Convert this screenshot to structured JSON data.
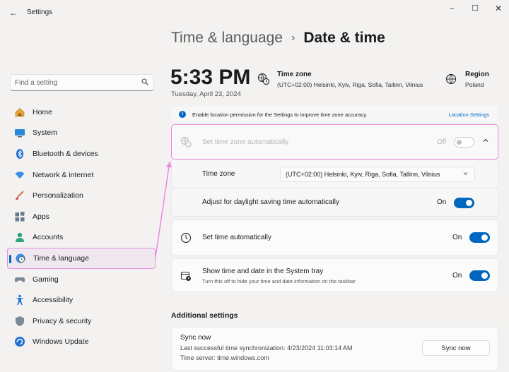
{
  "app": {
    "title": "Settings",
    "back_glyph": "←",
    "minimize_glyph": "–",
    "maximize_glyph": "☐",
    "close_glyph": "✕"
  },
  "search": {
    "placeholder": "Find a setting",
    "icon": "search-icon"
  },
  "sidebar": {
    "items": [
      {
        "label": "Home",
        "icon": "home-icon"
      },
      {
        "label": "System",
        "icon": "monitor-icon"
      },
      {
        "label": "Bluetooth & devices",
        "icon": "bluetooth-icon"
      },
      {
        "label": "Network & internet",
        "icon": "wifi-icon"
      },
      {
        "label": "Personalization",
        "icon": "brush-icon"
      },
      {
        "label": "Apps",
        "icon": "apps-icon"
      },
      {
        "label": "Accounts",
        "icon": "person-icon"
      },
      {
        "label": "Time & language",
        "icon": "globe-clock-icon",
        "active": true
      },
      {
        "label": "Gaming",
        "icon": "gamepad-icon"
      },
      {
        "label": "Accessibility",
        "icon": "accessibility-icon"
      },
      {
        "label": "Privacy & security",
        "icon": "shield-icon"
      },
      {
        "label": "Windows Update",
        "icon": "update-icon"
      }
    ]
  },
  "header": {
    "parent": "Time & language",
    "separator": "›",
    "current": "Date & time"
  },
  "clock": {
    "time": "5:33 PM",
    "date": "Tuesday, April 23, 2024",
    "timezone_label": "Time zone",
    "timezone_value": "(UTC+02:00) Helsinki, Kyiv, Riga, Sofia, Tallinn, Vilnius",
    "region_label": "Region",
    "region_value": "Poland"
  },
  "infobar": {
    "icon_glyph": "i",
    "text": "Enable location permission for the Settings to improve time zone accuracy.",
    "link": "Location Settings"
  },
  "settings": {
    "auto_tz": {
      "label": "Set time zone automatically",
      "state": "Off",
      "enabled": false
    },
    "time_zone": {
      "label": "Time zone",
      "value": "(UTC+02:00) Helsinki, Kyiv, Riga, Sofia, Tallinn, Vilnius"
    },
    "dst": {
      "label": "Adjust for daylight saving time automatically",
      "state": "On"
    },
    "auto_time": {
      "label": "Set time automatically",
      "state": "On"
    },
    "systray": {
      "label": "Show time and date in the System tray",
      "sub": "Turn this off to hide your time and date information on the taskbar",
      "state": "On"
    }
  },
  "additional": {
    "title": "Additional settings",
    "sync_title": "Sync now",
    "last_sync": "Last successful time synchronization: 4/23/2024 11:03:14 AM",
    "server": "Time server: time.windows.com",
    "sync_button": "Sync now"
  },
  "colors": {
    "accent": "#0067c0",
    "highlight": "#e98be3"
  }
}
